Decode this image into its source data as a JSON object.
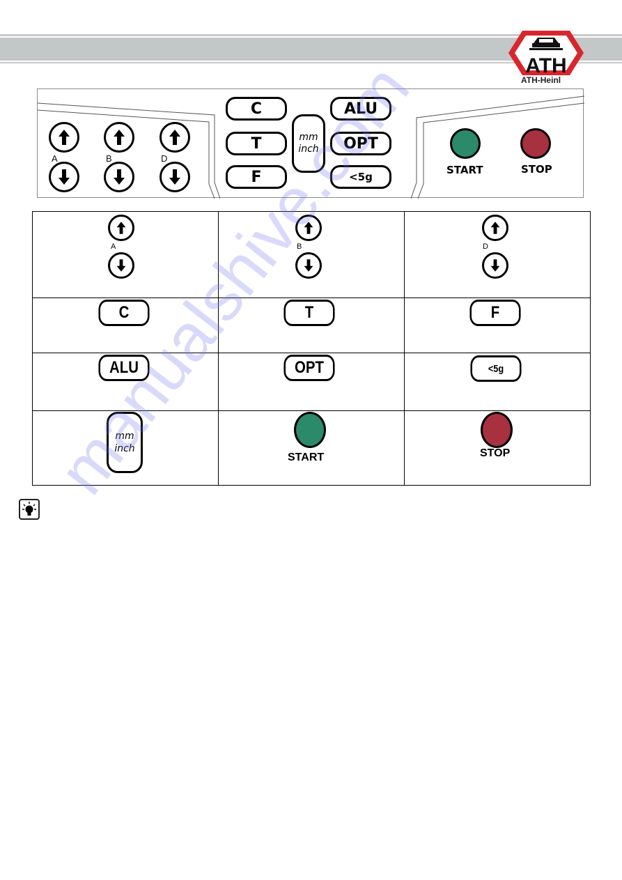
{
  "header": {
    "brand": "ATH-Heinl",
    "logo_letters": "ATH",
    "logo_colors": {
      "frame": "#d9262e",
      "mark": "#111111"
    },
    "band_color": "#c4c7c7"
  },
  "panel": {
    "axis_controls": [
      {
        "label": "A",
        "up_icon": "arrow-up-icon",
        "down_icon": "arrow-down-icon"
      },
      {
        "label": "B",
        "up_icon": "arrow-up-icon",
        "down_icon": "arrow-down-icon"
      },
      {
        "label": "D",
        "up_icon": "arrow-up-icon",
        "down_icon": "arrow-down-icon"
      }
    ],
    "left_keys": [
      "C",
      "T",
      "F"
    ],
    "unit_key": {
      "line1": "mm",
      "line2": "inch"
    },
    "right_keys": [
      "ALU",
      "OPT",
      "<5g"
    ],
    "start": {
      "label": "START",
      "color": "#2a8a6a"
    },
    "stop": {
      "label": "STOP",
      "color": "#a8313f"
    }
  },
  "legend_table": {
    "rows": [
      [
        {
          "type": "axis",
          "label": "A"
        },
        {
          "type": "axis",
          "label": "B"
        },
        {
          "type": "axis",
          "label": "D"
        }
      ],
      [
        {
          "type": "key",
          "label": "C"
        },
        {
          "type": "key",
          "label": "T"
        },
        {
          "type": "key",
          "label": "F"
        }
      ],
      [
        {
          "type": "key",
          "label": "ALU"
        },
        {
          "type": "key",
          "label": "OPT"
        },
        {
          "type": "key",
          "label": "<5g"
        }
      ],
      [
        {
          "type": "unit",
          "line1": "mm",
          "line2": "inch"
        },
        {
          "type": "lamp",
          "label": "START",
          "color": "#2a8a6a"
        },
        {
          "type": "lamp",
          "label": "STOP",
          "color": "#a8313f"
        }
      ]
    ]
  },
  "tip": {
    "icon": "lightbulb-icon"
  },
  "watermark": "manualshive.com"
}
